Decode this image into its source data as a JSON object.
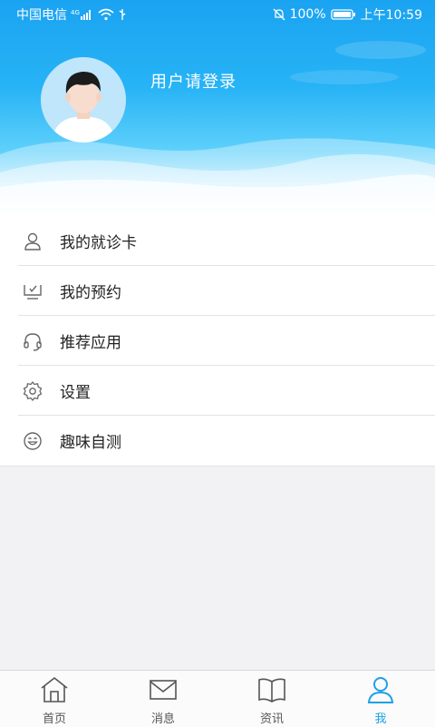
{
  "status_bar": {
    "carrier": "中国电信",
    "network": "4G",
    "battery": "100%",
    "time": "上午10:59"
  },
  "profile": {
    "login_prompt": "用户请登录",
    "avatar_icon": "default-avatar-icon"
  },
  "menu": {
    "items": [
      {
        "label": "我的就诊卡",
        "icon": "user-card-icon"
      },
      {
        "label": "我的预约",
        "icon": "monitor-icon"
      },
      {
        "label": "推荐应用",
        "icon": "headset-icon"
      },
      {
        "label": "设置",
        "icon": "gear-icon"
      },
      {
        "label": "趣味自测",
        "icon": "smile-icon"
      }
    ]
  },
  "tabbar": {
    "tabs": [
      {
        "label": "首页",
        "icon": "home-icon",
        "active": false
      },
      {
        "label": "消息",
        "icon": "envelope-icon",
        "active": false
      },
      {
        "label": "资讯",
        "icon": "book-icon",
        "active": false
      },
      {
        "label": "我",
        "icon": "person-icon",
        "active": true
      }
    ]
  },
  "colors": {
    "header": "#1aa3f1",
    "accent": "#1da1e8",
    "text": "#222222"
  }
}
